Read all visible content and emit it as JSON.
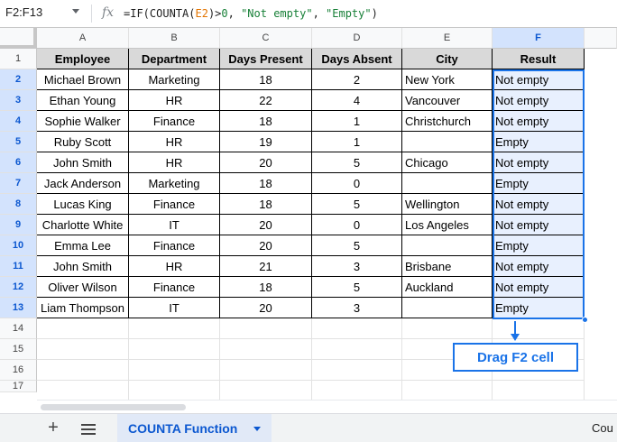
{
  "formula_bar": {
    "name_box": "F2:F13",
    "fx_label": "fx",
    "formula_parts": [
      "=IF(COUNTA(",
      "E2",
      ")>",
      "0",
      ", ",
      "\"Not empty\"",
      ", ",
      "\"Empty\"",
      ")"
    ]
  },
  "columns": [
    "A",
    "B",
    "C",
    "D",
    "E",
    "F"
  ],
  "selected_column": "F",
  "row_numbers": [
    "1",
    "2",
    "3",
    "4",
    "5",
    "6",
    "7",
    "8",
    "9",
    "10",
    "11",
    "12",
    "13",
    "14",
    "15",
    "16",
    "17"
  ],
  "table": {
    "headers": [
      "Employee",
      "Department",
      "Days Present",
      "Days Absent",
      "City",
      "Result"
    ],
    "rows": [
      [
        "Michael Brown",
        "Marketing",
        "18",
        "2",
        "New York",
        "Not empty"
      ],
      [
        "Ethan Young",
        "HR",
        "22",
        "4",
        "Vancouver",
        "Not empty"
      ],
      [
        "Sophie Walker",
        "Finance",
        "18",
        "1",
        "Christchurch",
        "Not empty"
      ],
      [
        "Ruby Scott",
        "HR",
        "19",
        "1",
        "",
        "Empty"
      ],
      [
        "John Smith",
        "HR",
        "20",
        "5",
        "Chicago",
        "Not empty"
      ],
      [
        "Jack Anderson",
        "Marketing",
        "18",
        "0",
        "",
        "Empty"
      ],
      [
        "Lucas King",
        "Finance",
        "18",
        "5",
        "Wellington",
        "Not empty"
      ],
      [
        "Charlotte White",
        "IT",
        "20",
        "0",
        "Los Angeles",
        "Not empty"
      ],
      [
        "Emma Lee",
        "Finance",
        "20",
        "5",
        "",
        "Empty"
      ],
      [
        "John Smith",
        "HR",
        "21",
        "3",
        "Brisbane",
        "Not empty"
      ],
      [
        "Oliver Wilson",
        "Finance",
        "18",
        "5",
        "Auckland",
        "Not empty"
      ],
      [
        "Liam Thompson",
        "IT",
        "20",
        "3",
        "",
        "Empty"
      ]
    ]
  },
  "callout": {
    "text": "Drag F2 cell"
  },
  "sheet_tabs": {
    "add_label": "+",
    "active_tab": "COUNTA Function",
    "next_tab_partial": "Cou"
  },
  "colors": {
    "selection": "#1a73e8",
    "header_fill": "#d9d9d9",
    "selected_fill": "#e8f0fe",
    "formula_ref": "#e37400",
    "formula_literal": "#188038"
  },
  "icons": [
    "caret-down-icon",
    "fx-icon",
    "add-sheet-icon",
    "all-sheets-menu-icon",
    "tab-caret-icon"
  ]
}
